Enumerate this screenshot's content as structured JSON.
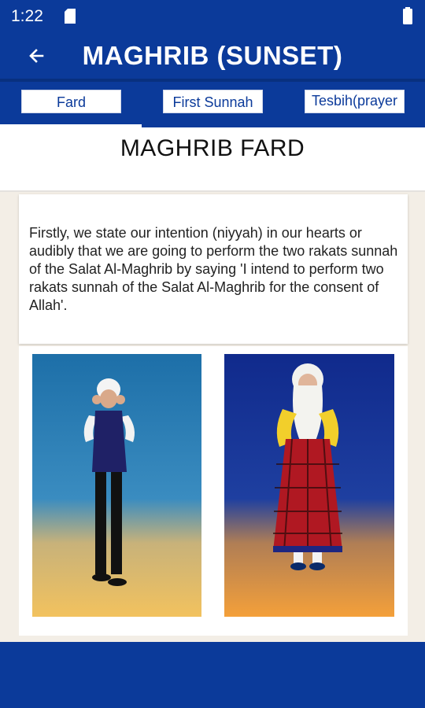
{
  "status_bar": {
    "time": "1:22",
    "icons": [
      "sd-card-icon",
      "battery-icon"
    ]
  },
  "app_bar": {
    "title": "MAGHRIB (SUNSET)",
    "back_icon": "arrow-left-icon"
  },
  "tabs": [
    {
      "label": "Fard",
      "selected": true
    },
    {
      "label": "First Sunnah",
      "selected": false
    },
    {
      "label": "Tesbih(prayer",
      "selected": false
    }
  ],
  "section": {
    "title": "MAGHRIB FARD"
  },
  "description": " Firstly, we state our intention (niyyah) in our hearts or audibly that we are going to perform the two rakats sunnah of the Salat Al-Maghrib by saying 'I intend to perform two rakats sunnah of the Salat Al-Maghrib for the consent of Allah'.",
  "illustrations": [
    {
      "subject": "man-praying-illustration"
    },
    {
      "subject": "girl-praying-illustration"
    }
  ],
  "colors": {
    "primary": "#0b3a9a",
    "background": "#f3eee6",
    "card": "#ffffff"
  }
}
